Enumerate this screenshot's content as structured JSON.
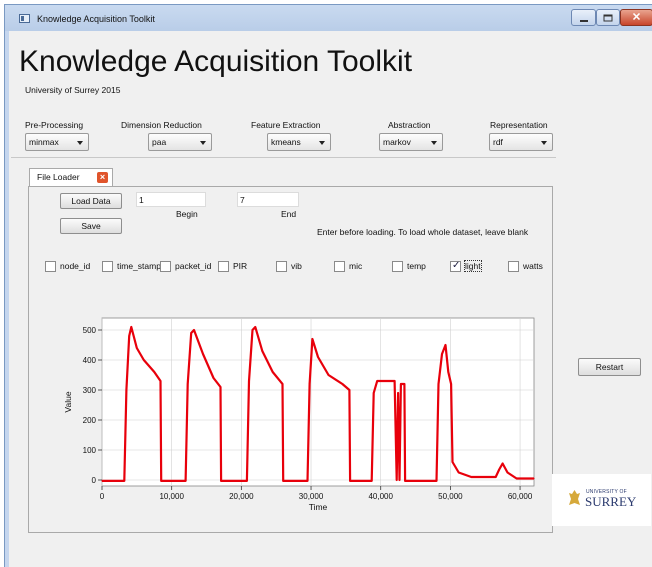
{
  "window": {
    "title": "Knowledge Acquisition Toolkit"
  },
  "header": {
    "title": "Knowledge Acquisition Toolkit",
    "subtitle": "University of Surrey 2015"
  },
  "parameters": [
    {
      "label": "Pre-Processing",
      "value": "minmax"
    },
    {
      "label": "Dimension Reduction",
      "value": "paa"
    },
    {
      "label": "Feature Extraction",
      "value": "kmeans"
    },
    {
      "label": "Abstraction",
      "value": "markov"
    },
    {
      "label": "Representation",
      "value": "rdf"
    }
  ],
  "tab": {
    "label": "File Loader"
  },
  "loader": {
    "load_label": "Load Data",
    "save_label": "Save",
    "begin_value": "1",
    "begin_label": "Begin",
    "end_value": "7",
    "end_label": "End",
    "hint": "Enter before loading. To load whole dataset, leave blank"
  },
  "columns": [
    {
      "label": "node_id",
      "checked": false
    },
    {
      "label": "time_stamp",
      "checked": false
    },
    {
      "label": "packet_id",
      "checked": false
    },
    {
      "label": "PIR",
      "checked": false
    },
    {
      "label": "vib",
      "checked": false
    },
    {
      "label": "mic",
      "checked": false
    },
    {
      "label": "temp",
      "checked": false
    },
    {
      "label": "light",
      "checked": true
    },
    {
      "label": "watts",
      "checked": false
    }
  ],
  "restart_label": "Restart",
  "logo": {
    "line1": "UNIVERSITY OF",
    "line2": "SURREY"
  },
  "colors": {
    "series": "#e8000b",
    "grid": "#d0d0d0",
    "title_bar": "#c9daf0"
  },
  "chart_data": {
    "type": "line",
    "title": "",
    "xlabel": "Time",
    "ylabel": "Value",
    "xlim": [
      0,
      62000
    ],
    "ylim": [
      -20,
      540
    ],
    "x_ticks": [
      0,
      10000,
      20000,
      30000,
      40000,
      50000,
      60000
    ],
    "x_tick_labels": [
      "0",
      "10,000",
      "20,000",
      "30,000",
      "40,000",
      "50,000",
      "60,000"
    ],
    "y_ticks": [
      0,
      100,
      200,
      300,
      400,
      500
    ],
    "y_tick_labels": [
      "0",
      "100",
      "200",
      "300",
      "400",
      "500"
    ],
    "grid": true,
    "series": [
      {
        "values": [
          [
            0,
            -3
          ],
          [
            3200,
            -3
          ],
          [
            3500,
            300
          ],
          [
            3900,
            480
          ],
          [
            4200,
            510
          ],
          [
            5000,
            440
          ],
          [
            6000,
            400
          ],
          [
            7500,
            360
          ],
          [
            8400,
            330
          ],
          [
            8500,
            -3
          ],
          [
            12000,
            -3
          ],
          [
            12300,
            320
          ],
          [
            12800,
            490
          ],
          [
            13200,
            500
          ],
          [
            14500,
            420
          ],
          [
            16000,
            340
          ],
          [
            17000,
            310
          ],
          [
            17100,
            -3
          ],
          [
            20800,
            -3
          ],
          [
            21100,
            330
          ],
          [
            21600,
            500
          ],
          [
            22000,
            510
          ],
          [
            23000,
            430
          ],
          [
            24500,
            360
          ],
          [
            25900,
            320
          ],
          [
            26000,
            -3
          ],
          [
            29500,
            -3
          ],
          [
            29800,
            320
          ],
          [
            30200,
            470
          ],
          [
            31000,
            410
          ],
          [
            32500,
            350
          ],
          [
            34500,
            320
          ],
          [
            35500,
            300
          ],
          [
            35600,
            -3
          ],
          [
            38700,
            -3
          ],
          [
            39000,
            290
          ],
          [
            39500,
            330
          ],
          [
            42000,
            330
          ],
          [
            42300,
            0
          ],
          [
            42500,
            290
          ],
          [
            42700,
            0
          ],
          [
            42900,
            320
          ],
          [
            43400,
            320
          ],
          [
            43500,
            -3
          ],
          [
            48000,
            -3
          ],
          [
            48300,
            320
          ],
          [
            48800,
            420
          ],
          [
            49300,
            450
          ],
          [
            49700,
            360
          ],
          [
            50100,
            320
          ],
          [
            50300,
            60
          ],
          [
            51200,
            25
          ],
          [
            53000,
            10
          ],
          [
            56500,
            10
          ],
          [
            57000,
            35
          ],
          [
            57500,
            55
          ],
          [
            58200,
            25
          ],
          [
            59500,
            5
          ],
          [
            62000,
            5
          ]
        ]
      }
    ]
  }
}
